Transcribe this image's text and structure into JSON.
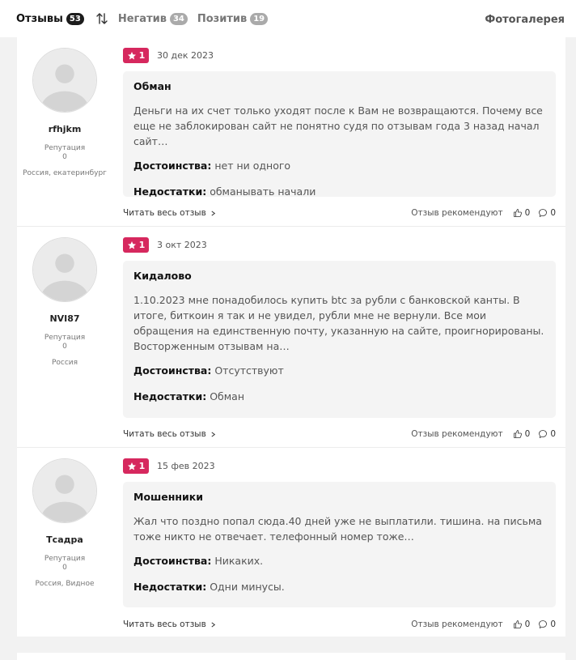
{
  "tabs": [
    {
      "label": "Отзывы",
      "count": "53"
    },
    {
      "label": "Негатив",
      "count": "34"
    },
    {
      "label": "Позитив",
      "count": "19"
    }
  ],
  "sort_icon": "sort-arrows-icon",
  "gallery_label": "Фотогалерея",
  "colors": {
    "rating_badge": "#d6285e",
    "active_badge": "#1c1c1c",
    "inactive_badge": "#aaaaaa",
    "card_bg": "#f4f4f4"
  },
  "labels": {
    "reputation": "Репутация",
    "pros": "Достоинства:",
    "cons": "Недостатки:",
    "read_more": "Читать весь отзыв",
    "recommend": "Отзыв рекомендуют"
  },
  "reviews": [
    {
      "author": "rfhjkm",
      "reputation": "0",
      "location": "Россия, екатеринбург",
      "rating": "1",
      "date": "30 дек 2023",
      "title": "Обман",
      "text": "Деньги на их счет только уходят после к Вам не возвращаются. Почему все еще не заблокирован сайт не понятно судя по отзывам года 3 назад начал сайт…",
      "pros": "нет ни одного",
      "cons": "обманывать начали",
      "likes": "0",
      "comments": "0"
    },
    {
      "author": "NVI87",
      "reputation": "0",
      "location": "Россия",
      "rating": "1",
      "date": "3 окт 2023",
      "title": "Кидалово",
      "text": "1.10.2023 мне понадобилось купить btc за рубли с банковской канты. В итоге, биткоин я так и не увидел, рубли мне не вернули. Все мои обращения на единственную почту, указанную на сайте, проигнорированы. Восторженным отзывам на…",
      "pros": "Отсутствуют",
      "cons": "Обман",
      "likes": "0",
      "comments": "0"
    },
    {
      "author": "Тсадра",
      "reputation": "0",
      "location": "Россия, Видное",
      "rating": "1",
      "date": "15 фев 2023",
      "title": "Мошенники",
      "text": "Жал что поздно попал сюда.40 дней уже не выплатили. тишина. на письма тоже никто не отвечает. телефонный номер тоже…",
      "pros": "Никаких.",
      "cons": "Одни минусы.",
      "likes": "0",
      "comments": "0"
    }
  ]
}
